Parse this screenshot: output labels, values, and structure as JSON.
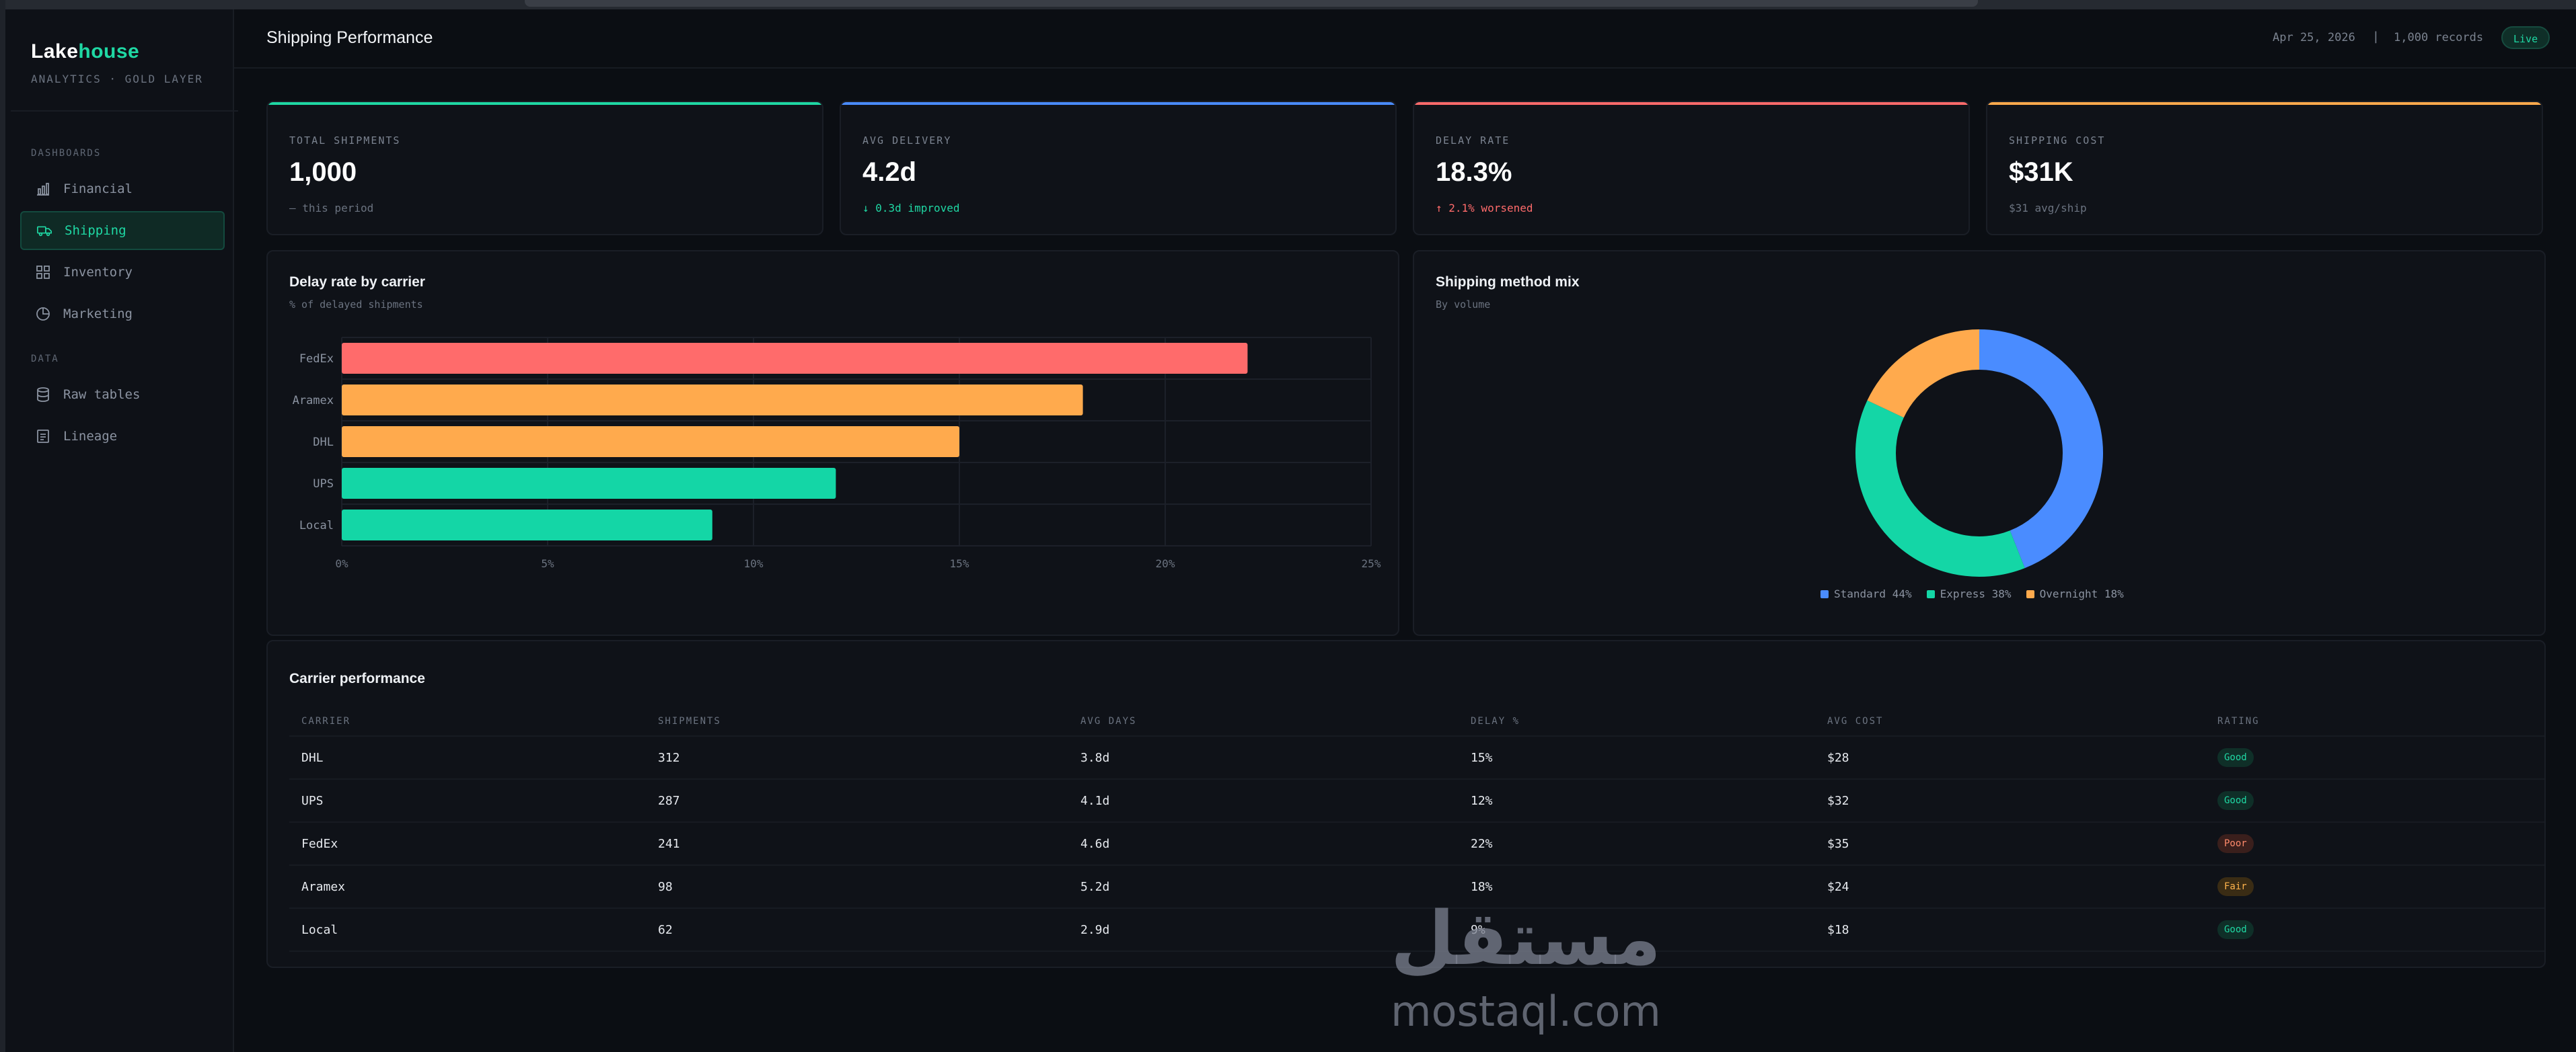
{
  "sidebar": {
    "brand_a": "Lake",
    "brand_b": "house",
    "brand_sub": "ANALYTICS · GOLD LAYER",
    "section_dashboards": "DASHBOARDS",
    "section_data": "DATA",
    "items": [
      {
        "label": "Financial",
        "icon": "bar-chart-icon"
      },
      {
        "label": "Shipping",
        "icon": "truck-icon",
        "active": true
      },
      {
        "label": "Inventory",
        "icon": "grid-icon"
      },
      {
        "label": "Marketing",
        "icon": "pie-icon"
      },
      {
        "label": "Raw tables",
        "icon": "database-icon"
      },
      {
        "label": "Lineage",
        "icon": "document-icon"
      }
    ]
  },
  "header": {
    "title": "Shipping Performance",
    "date": "Apr 25, 2026",
    "separator": "|",
    "records": "1,000 records",
    "live": "Live"
  },
  "kpis": [
    {
      "label": "TOTAL SHIPMENTS",
      "value": "1,000",
      "sub": "— this period",
      "color": "#1fd8a4",
      "sub_color": "#6b7380"
    },
    {
      "label": "AVG DELIVERY",
      "value": "4.2d",
      "sub": "↓ 0.3d improved",
      "color": "#4a8cff",
      "sub_color": "#1fd8a4"
    },
    {
      "label": "DELAY RATE",
      "value": "18.3%",
      "sub": "↑ 2.1% worsened",
      "color": "#ff6b6b",
      "sub_color": "#ff6b6b"
    },
    {
      "label": "SHIPPING COST",
      "value": "$31K",
      "sub": "$31 avg/ship",
      "color": "#ffaa4d",
      "sub_color": "#6b7380"
    }
  ],
  "delay_panel": {
    "title": "Delay rate by carrier",
    "subtitle": "% of delayed shipments"
  },
  "mix_panel": {
    "title": "Shipping method mix",
    "subtitle": "By volume",
    "legend": [
      {
        "label": "Standard 44%",
        "color": "#4a8cff"
      },
      {
        "label": "Express 38%",
        "color": "#14d6a6"
      },
      {
        "label": "Overnight 18%",
        "color": "#ffaa4d"
      }
    ]
  },
  "chart_data": [
    {
      "type": "bar",
      "orientation": "horizontal",
      "categories": [
        "FedEx",
        "Aramex",
        "DHL",
        "UPS",
        "Local"
      ],
      "values": [
        22,
        18,
        15,
        12,
        9
      ],
      "colors": [
        "#ff6b6b",
        "#ffaa4d",
        "#ffaa4d",
        "#14d6a6",
        "#14d6a6"
      ],
      "title": "Delay rate by carrier",
      "subtitle": "% of delayed shipments",
      "xlim": [
        0,
        25
      ],
      "xticks": [
        "0%",
        "5%",
        "10%",
        "15%",
        "20%",
        "25%"
      ],
      "grid": true
    },
    {
      "type": "pie",
      "donut": true,
      "categories": [
        "Standard",
        "Express",
        "Overnight"
      ],
      "values": [
        44,
        38,
        18
      ],
      "colors": [
        "#4a8cff",
        "#14d6a6",
        "#ffaa4d"
      ],
      "title": "Shipping method mix",
      "subtitle": "By volume",
      "legend_position": "bottom"
    }
  ],
  "table": {
    "title": "Carrier performance",
    "columns": [
      "CARRIER",
      "SHIPMENTS",
      "AVG DAYS",
      "DELAY %",
      "AVG COST",
      "RATING"
    ],
    "rows": [
      {
        "carrier": "DHL",
        "shipments": "312",
        "avg_days": "3.8d",
        "delay": "15%",
        "cost": "$28",
        "rating": "Good"
      },
      {
        "carrier": "UPS",
        "shipments": "287",
        "avg_days": "4.1d",
        "delay": "12%",
        "cost": "$32",
        "rating": "Good"
      },
      {
        "carrier": "FedEx",
        "shipments": "241",
        "avg_days": "4.6d",
        "delay": "22%",
        "cost": "$35",
        "rating": "Poor"
      },
      {
        "carrier": "Aramex",
        "shipments": "98",
        "avg_days": "5.2d",
        "delay": "18%",
        "cost": "$24",
        "rating": "Fair"
      },
      {
        "carrier": "Local",
        "shipments": "62",
        "avg_days": "2.9d",
        "delay": "9%",
        "cost": "$18",
        "rating": "Good"
      }
    ],
    "rating_colors": {
      "Good": {
        "bg": "#0f2f28",
        "fg": "#1fd8a4"
      },
      "Poor": {
        "bg": "#3a1f1c",
        "fg": "#ff8a6b"
      },
      "Fair": {
        "bg": "#3a2c14",
        "fg": "#ffb44d"
      }
    }
  },
  "watermark": {
    "arabic": "مستقل",
    "latin": "mostaql.com"
  }
}
